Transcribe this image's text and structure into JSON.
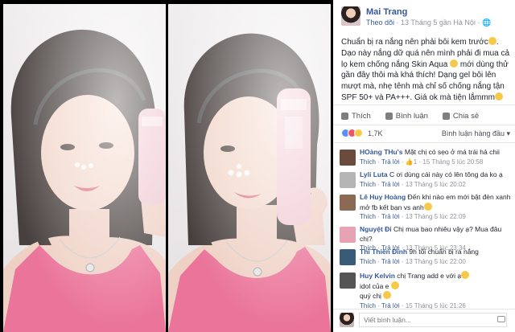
{
  "post": {
    "author": "Mai Trang",
    "follow_label": "Theo dõi",
    "meta_text": " · 13 Tháng 5 gần Hà Nội · ",
    "caption_1": "Chuẩn bị ra nắng nên phải bôi kem trước",
    "caption_2": ". Dạo này nắng dữ quá nên mình phải đi mua cả lọ kem chống nắng Skin Aqua ",
    "caption_3": " mới dùng thử gần đây thôi mà khá thích! Dạng gel bôi lên mượt mà, nhẹ tênh mà chỉ số chống nắng tận SPF 50+ và PA+++. Giá ok mà tiện lắmmm"
  },
  "actions": {
    "like": "Thích",
    "comment": "Bình luận",
    "share": "Chia sẻ"
  },
  "reactions": {
    "count": "1,7K",
    "sort_label": "Bình luận hàng đầu ▾"
  },
  "comments": [
    {
      "name": "HOàng THu's",
      "text": " Mặt chị có sẹo ở má trái hả chii",
      "like": "Thích",
      "reply": "Trả lời",
      "extra": " · 👍1 · 15 Tháng 5 lúc 20:58",
      "avatar_color": "#6b4b3e"
    },
    {
      "name": "Lyli Luta",
      "text": " C ơi dùng cái này có lên tông da ko ạ",
      "like": "Thích",
      "reply": "Trả lời",
      "extra": " · 13 Tháng 5 lúc 20:02",
      "avatar_color": "#b5b5b5"
    },
    {
      "name": "Lê Huy Hoàng",
      "text": " Đến khi nào em mới bật đèn xanh mở fb kết bạn vs anh",
      "like": "Thích",
      "reply": "Trả lời",
      "extra": " · 13 Tháng 5 lúc 22:09",
      "avatar_color": "#8a6a55"
    },
    {
      "name": "Nguyệt Đi",
      "text": " Chị mua bao nhiêu vậy ạ? Mua đâu chị?",
      "like": "Thích",
      "reply": "Trả lời",
      "extra": " · 13 Tháng 5 lúc 23:34",
      "avatar_color": "#e7a2b4"
    },
    {
      "name": "Thi Thiên Đình",
      "text": " 9h tối chuẩn bị ra nắng",
      "like": "Thích",
      "reply": "Trả lời",
      "extra": " · 13 Tháng 5 lúc 22:00",
      "avatar_color": "#3a5a7a"
    },
    {
      "name": "Huy Kelvin",
      "text": " chị Trang add e với ạ",
      "text_2": "idol của e",
      "text_3": "quý chị",
      "like": "Thích",
      "reply": "Trả lời",
      "extra": " · 15 Tháng 5 lúc 21:26",
      "avatar_color": "#555555"
    }
  ],
  "reply_box": {
    "placeholder": "Viết bình luận..."
  },
  "colors": {
    "link": "#365899",
    "muted": "#90949c",
    "photo_bg": "#000000",
    "tank_top": "#ee5b8a",
    "bottle": "#f3c6d1"
  }
}
